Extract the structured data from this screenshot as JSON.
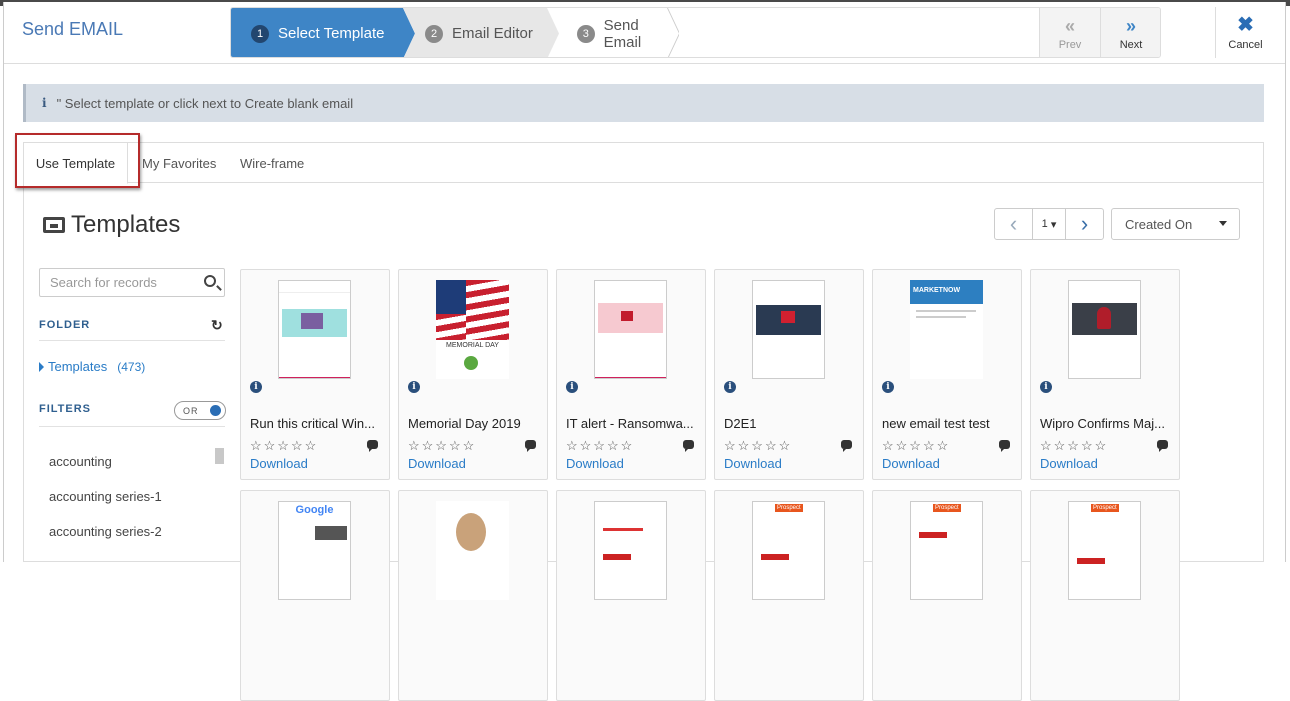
{
  "modal": {
    "title": "Send EMAIL",
    "steps": [
      {
        "num": "1",
        "label": "Select Template"
      },
      {
        "num": "2",
        "label": "Email Editor"
      },
      {
        "num": "3",
        "label": "Send Email"
      }
    ],
    "prev_label": "Prev",
    "next_label": "Next",
    "cancel_label": "Cancel"
  },
  "info_message": "\" Select template or click next to Create blank email",
  "tabs": [
    {
      "label": "Use Template"
    },
    {
      "label": "My Favorites"
    },
    {
      "label": "Wire-frame"
    }
  ],
  "templates_heading": "Templates",
  "pager": {
    "page": "1"
  },
  "sort": {
    "selected": "Created On"
  },
  "sidebar": {
    "search_placeholder": "Search for records",
    "folder_label": "FOLDER",
    "folder_name": "Templates",
    "folder_count": "(473)",
    "filters_label": "FILTERS",
    "toggle_label": "OR",
    "filters": [
      "accounting",
      "accounting series-1",
      "accounting series-2"
    ]
  },
  "cards": [
    {
      "name": "Run this critical Win...",
      "stars": "☆☆☆☆☆",
      "download": "Download"
    },
    {
      "name": "Memorial Day 2019",
      "stars": "☆☆☆☆☆",
      "download": "Download"
    },
    {
      "name": "IT alert - Ransomwa...",
      "stars": "☆☆☆☆☆",
      "download": "Download"
    },
    {
      "name": "D2E1",
      "stars": "☆☆☆☆☆",
      "download": "Download"
    },
    {
      "name": "new email test test",
      "stars": "☆☆☆☆☆",
      "download": "Download"
    },
    {
      "name": "Wipro Confirms Maj...",
      "stars": "☆☆☆☆☆",
      "download": "Download"
    }
  ],
  "thumb_text": {
    "memorial": "MEMORIAL DAY",
    "marketnow": "MARKETNOW",
    "google": "Google",
    "prospect": "Prospect"
  },
  "colors": {
    "accent": "#3e85c6",
    "title": "#4a79b5",
    "link": "#2a7cc7",
    "highlight_box": "#b52b2b"
  },
  "icons": {
    "info": "info-icon",
    "prev": "double-chevron-left-icon",
    "next": "double-chevron-right-icon",
    "cancel": "close-icon",
    "tray": "inbox-tray-icon",
    "search": "search-icon",
    "refresh": "refresh-icon",
    "comment": "comment-icon"
  }
}
